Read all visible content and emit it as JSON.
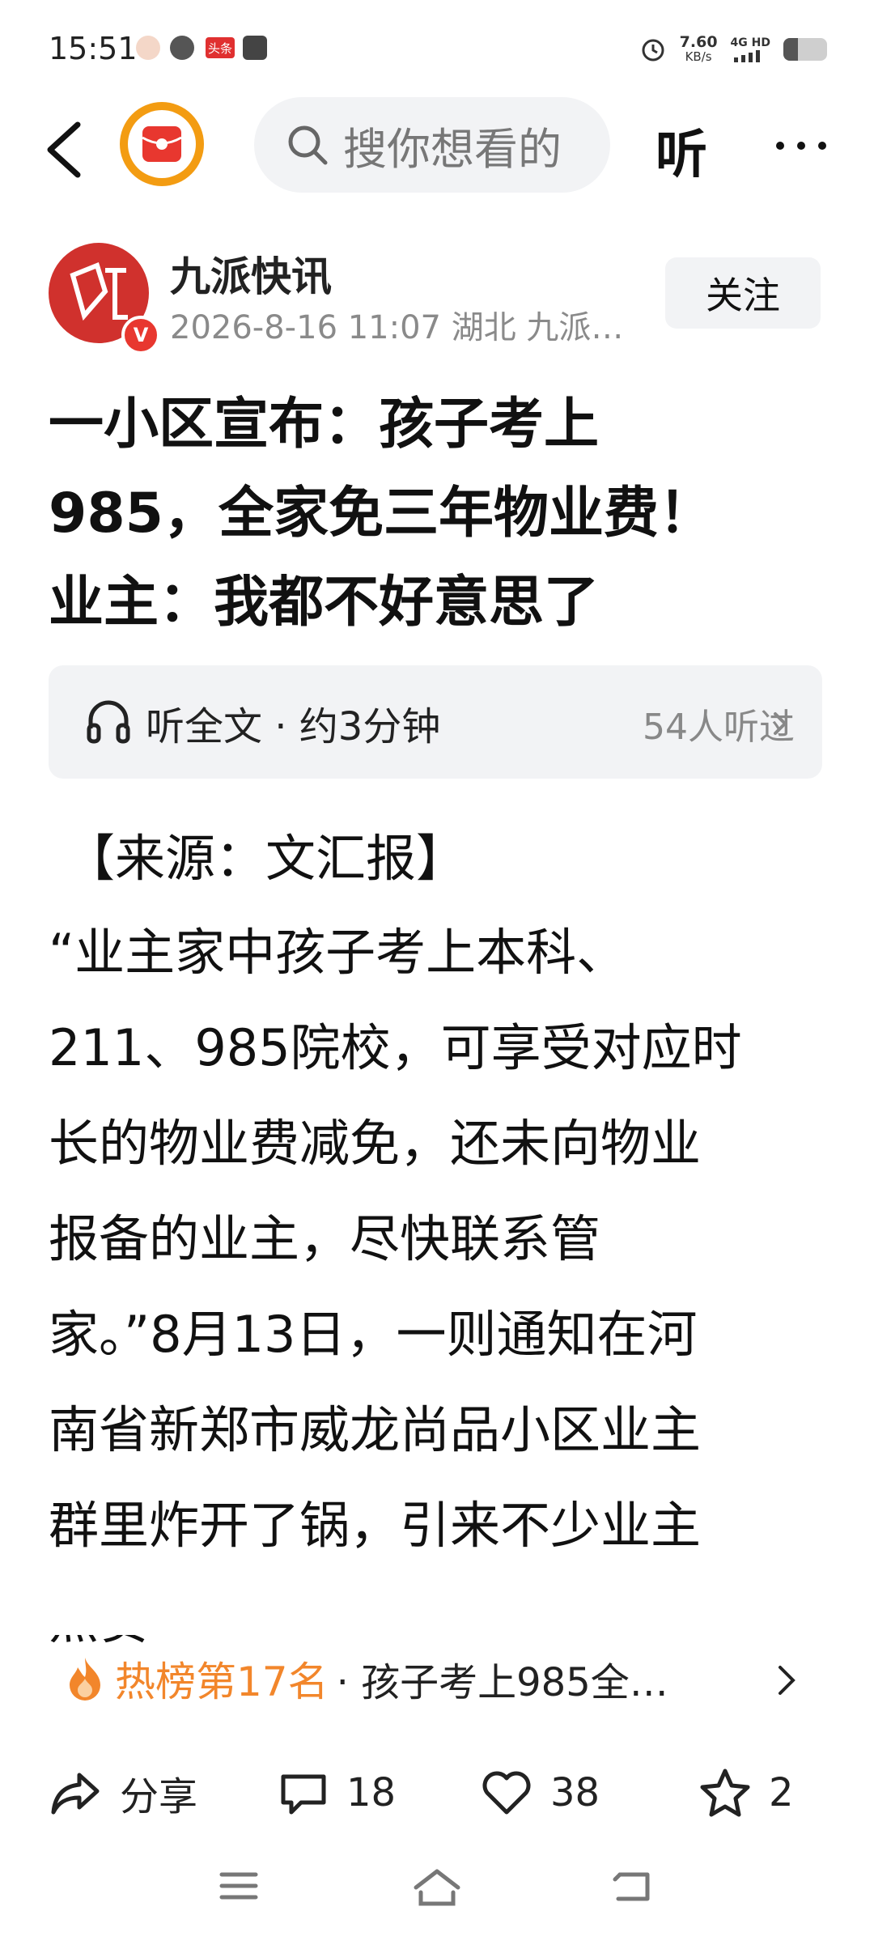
{
  "status_bar": {
    "time": "15:51",
    "speed_value": "7.60",
    "speed_unit": "KB/s",
    "network": "4G HD",
    "news_badge": "头条"
  },
  "top_bar": {
    "search_placeholder": "搜你想看的",
    "listen_label": "听"
  },
  "author": {
    "name": "九派快讯",
    "meta": "2026-8-16  11:07  湖北  九派…",
    "follow_label": "关注",
    "verify_mark": "V"
  },
  "article": {
    "title_lines": [
      "一小区宣布：孩子考上",
      "985，全家免三年物业费！",
      "业主：我都不好意思了"
    ],
    "listen": {
      "text": "听全文 · 约3分钟",
      "count": "54人听过"
    },
    "source": "【来源：文汇报】",
    "body_lines": [
      "“业主家中孩子考上本科、",
      "211、985院校，可享受对应时",
      "长的物业费减免，还未向物业",
      "报备的业主，尽快联系管",
      "家。”8月13日，一则通知在河",
      "南省新郑市威龙尚品小区业主",
      "群里炸开了锅，引来不少业主",
      "点赞"
    ]
  },
  "hot_bar": {
    "rank": "热榜第17名",
    "topic": "· 孩子考上985全…"
  },
  "actions": {
    "share": "分享",
    "comments": "18",
    "likes": "38",
    "favorites": "2"
  },
  "colors": {
    "accent_orange": "#f2862b",
    "brand_red": "#d0312d",
    "logo_ring": "#f39c12"
  }
}
